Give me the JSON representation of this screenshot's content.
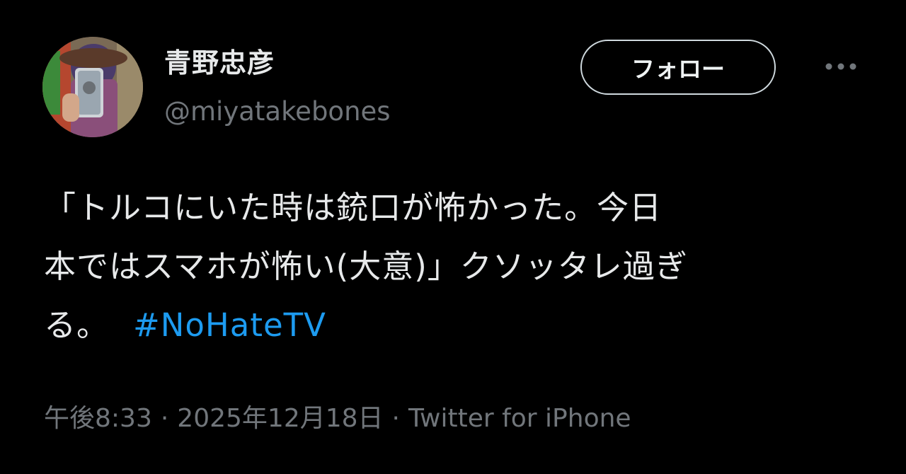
{
  "tweet": {
    "author": {
      "display_name": "青野忠彦",
      "handle": "@miyatakebones"
    },
    "follow_label": "フォロー",
    "more_icon": "more-horizontal-icon",
    "text_line1": "「トルコにいた時は銃口が怖かった。今日",
    "text_line2": "本ではスマホが怖い(大意)」クソッタレ過ぎ",
    "text_line3": "る。",
    "hashtag": "#NoHateTV",
    "time": "午後8:33",
    "separator": "·",
    "date": "2025年12月18日",
    "source": "Twitter for iPhone"
  },
  "colors": {
    "background": "#000000",
    "text": "#e7e9ea",
    "secondary": "#71767b",
    "link": "#1d9bf0"
  }
}
